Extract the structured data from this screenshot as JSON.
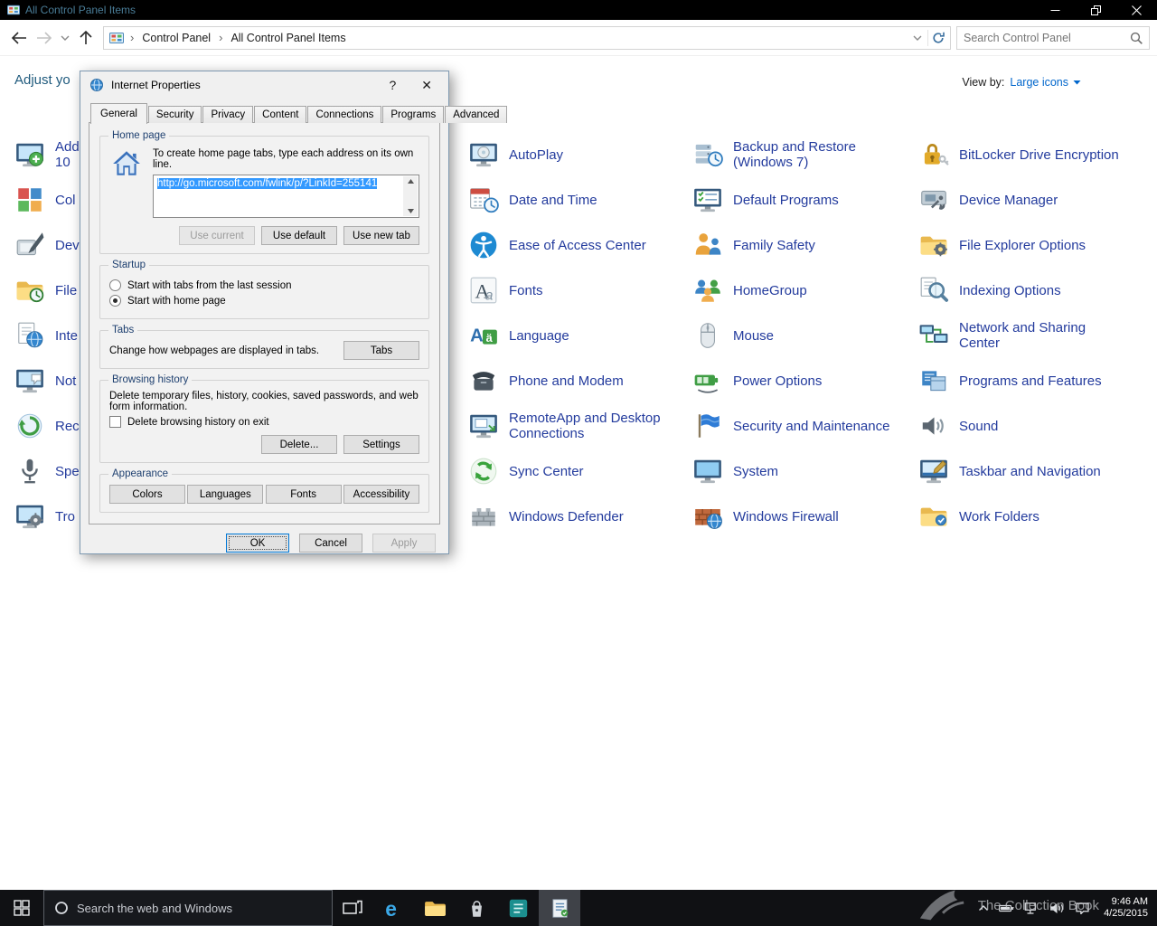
{
  "titlebar": {
    "title": "All Control Panel Items"
  },
  "toolbar": {
    "breadcrumb": [
      "Control Panel",
      "All Control Panel Items"
    ],
    "separator": "›",
    "search_placeholder": "Search Control Panel"
  },
  "page": {
    "heading_visible_text": "Adjust yo",
    "view_by_label": "View by:",
    "view_by_value": "Large icons"
  },
  "items": {
    "column1": [
      {
        "label": "Add\n10",
        "icon": "add-features-icon"
      },
      {
        "label": "Col",
        "icon": "color-management-icon"
      },
      {
        "label": "Dev",
        "icon": "devices-icon"
      },
      {
        "label": "File",
        "icon": "file-history-icon"
      },
      {
        "label": "Inte",
        "icon": "internet-options-icon"
      },
      {
        "label": "Not",
        "icon": "notification-icons-icon"
      },
      {
        "label": "Rec",
        "icon": "recovery-icon"
      },
      {
        "label": "Spe",
        "icon": "speech-icon"
      },
      {
        "label": "Tro",
        "icon": "troubleshooting-icon"
      }
    ],
    "column2": [
      {
        "label": "AutoPlay",
        "icon": "autoplay-icon"
      },
      {
        "label": "Date and Time",
        "icon": "date-time-icon"
      },
      {
        "label": "Ease of Access Center",
        "icon": "ease-of-access-icon"
      },
      {
        "label": "Fonts",
        "icon": "fonts-icon"
      },
      {
        "label": "Language",
        "icon": "language-icon"
      },
      {
        "label": "Phone and Modem",
        "icon": "phone-modem-icon"
      },
      {
        "label": "RemoteApp and Desktop\nConnections",
        "icon": "remoteapp-icon"
      },
      {
        "label": "Sync Center",
        "icon": "sync-center-icon"
      },
      {
        "label": "Windows Defender",
        "icon": "windows-defender-icon"
      }
    ],
    "column3": [
      {
        "label": "Backup and Restore\n(Windows 7)",
        "icon": "backup-restore-icon"
      },
      {
        "label": "Default Programs",
        "icon": "default-programs-icon"
      },
      {
        "label": "Family Safety",
        "icon": "family-safety-icon"
      },
      {
        "label": "HomeGroup",
        "icon": "homegroup-icon"
      },
      {
        "label": "Mouse",
        "icon": "mouse-icon"
      },
      {
        "label": "Power Options",
        "icon": "power-options-icon"
      },
      {
        "label": "Security and Maintenance",
        "icon": "security-maintenance-icon"
      },
      {
        "label": "System",
        "icon": "system-icon"
      },
      {
        "label": "Windows Firewall",
        "icon": "windows-firewall-icon"
      }
    ],
    "column4": [
      {
        "label": "BitLocker Drive Encryption",
        "icon": "bitlocker-icon"
      },
      {
        "label": "Device Manager",
        "icon": "device-manager-icon"
      },
      {
        "label": "File Explorer Options",
        "icon": "file-explorer-options-icon"
      },
      {
        "label": "Indexing Options",
        "icon": "indexing-options-icon"
      },
      {
        "label": "Network and Sharing\nCenter",
        "icon": "network-sharing-icon"
      },
      {
        "label": "Programs and Features",
        "icon": "programs-features-icon"
      },
      {
        "label": "Sound",
        "icon": "sound-icon"
      },
      {
        "label": "Taskbar and Navigation",
        "icon": "taskbar-navigation-icon"
      },
      {
        "label": "Work Folders",
        "icon": "work-folders-icon"
      }
    ]
  },
  "dialog": {
    "title": "Internet Properties",
    "caption_help": "?",
    "caption_close": "✕",
    "tabs": [
      "General",
      "Security",
      "Privacy",
      "Content",
      "Connections",
      "Programs",
      "Advanced"
    ],
    "active_tab": "General",
    "home_page": {
      "group_label": "Home page",
      "instruction": "To create home page tabs, type each address on its own line.",
      "url_value": "http://go.microsoft.com/fwlink/p/?LinkId=255141",
      "buttons": {
        "use_current": "Use current",
        "use_default": "Use default",
        "use_new_tab": "Use new tab"
      }
    },
    "startup": {
      "group_label": "Startup",
      "option_last_session": "Start with tabs from the last session",
      "option_home_page": "Start with home page",
      "selected_option": "Start with home page"
    },
    "tabs_group": {
      "group_label": "Tabs",
      "description": "Change how webpages are displayed in tabs.",
      "button_label": "Tabs"
    },
    "browsing_history": {
      "group_label": "Browsing history",
      "description": "Delete temporary files, history, cookies, saved passwords, and web form information.",
      "checkbox_label": "Delete browsing history on exit",
      "checkbox_checked": false,
      "delete_button": "Delete...",
      "settings_button": "Settings"
    },
    "appearance": {
      "group_label": "Appearance",
      "buttons": [
        "Colors",
        "Languages",
        "Fonts",
        "Accessibility"
      ]
    },
    "footer": {
      "ok": "OK",
      "cancel": "Cancel",
      "apply": "Apply"
    }
  },
  "taskbar": {
    "search_placeholder": "Search the web and Windows",
    "pinned_apps": [
      {
        "name": "edge",
        "icon": "edge-icon",
        "active": false
      },
      {
        "name": "file-explorer",
        "icon": "file-explorer-icon",
        "active": false
      },
      {
        "name": "store",
        "icon": "store-icon",
        "active": false
      },
      {
        "name": "collection-book",
        "icon": "collection-app-icon",
        "active": false
      },
      {
        "name": "control-panel",
        "icon": "active-window-icon",
        "active": true
      }
    ],
    "tray_icons": [
      "chevron-up-icon",
      "battery-icon",
      "network-icon",
      "volume-icon",
      "action-center-icon"
    ],
    "clock": {
      "time": "9:46 AM",
      "date": "4/25/2015"
    },
    "watermark": "The Collection Book"
  }
}
